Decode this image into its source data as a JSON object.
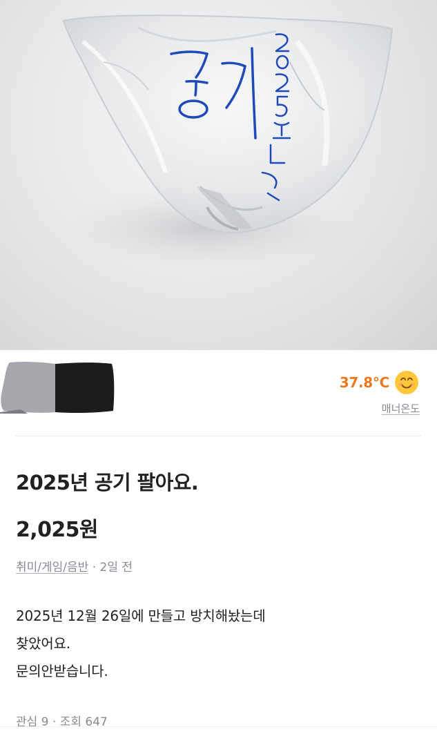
{
  "listing": {
    "photo_handwriting_main": "공기",
    "photo_handwriting_date": "2025년",
    "seller": {
      "temperature": "37.8°C",
      "temperature_color": "#e9781e",
      "temperature_icon": "smiling-face-icon",
      "manner_label": "매너온도"
    },
    "title": "2025년 공기 팔아요.",
    "price": "2,025원",
    "category": "취미/게임/음반",
    "separator": " · ",
    "posted_time": "2일 전",
    "description": [
      "2025년 12월 26일에 만들고 방치해놨는데",
      "찾았어요.",
      "문의안받습니다."
    ],
    "stats": {
      "interest": "관심 9",
      "separator": " · ",
      "views": "조회 647"
    }
  }
}
